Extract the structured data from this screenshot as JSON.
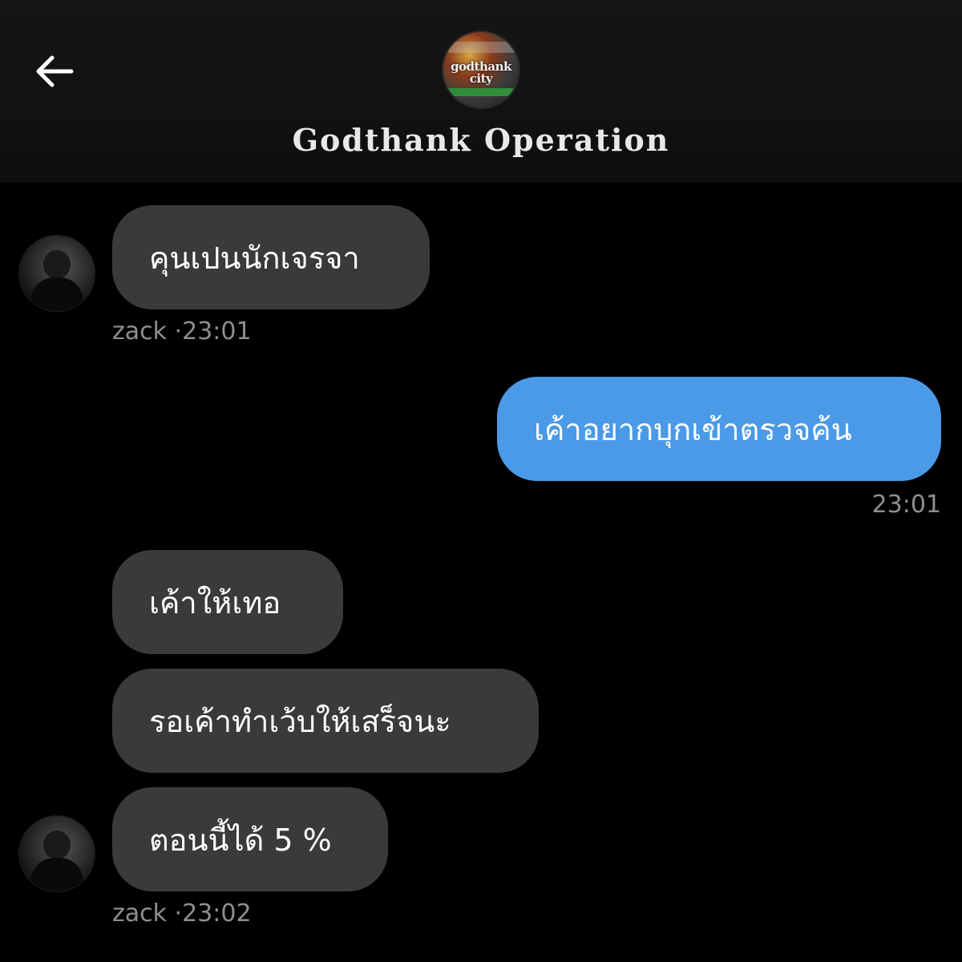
{
  "header": {
    "back_icon": "arrow-left-icon",
    "group_avatar_text": "godthank city",
    "title": "Godthank Operation"
  },
  "messages": [
    {
      "direction": "in",
      "text": "คุนเปนนักเจรจา",
      "sender": "zack",
      "time": "·23:01"
    },
    {
      "direction": "out",
      "text": "เค้าอยากบุกเข้าตรวจค้น",
      "time": "23:01"
    },
    {
      "direction": "in",
      "text": "เค้าให้เทอ"
    },
    {
      "direction": "in",
      "text": "รอเค้าทำเว้บให้เสร็จนะ"
    },
    {
      "direction": "in",
      "text": "ตอนนี้ได้ 5 %",
      "sender": "zack",
      "time": "·23:02"
    }
  ],
  "colors": {
    "background": "#000000",
    "header_bg": "#121212",
    "incoming_bubble": "#3a3a3c",
    "outgoing_bubble": "#4a9ae8",
    "meta_text": "#8e8e93"
  }
}
